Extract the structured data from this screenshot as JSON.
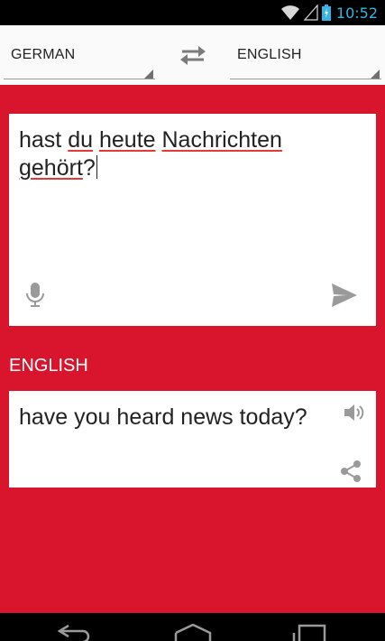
{
  "status_bar": {
    "time": "10:52",
    "icons": [
      "wifi-icon",
      "signal-icon",
      "battery-charging-icon"
    ],
    "time_color": "#33b5e5"
  },
  "language_bar": {
    "source_language": "GERMAN",
    "target_language": "ENGLISH",
    "swap_icon": "swap-arrows-icon"
  },
  "input": {
    "words": [
      "hast",
      "du",
      "heute",
      "Nachrichten",
      "gehört",
      "?"
    ],
    "mic_icon": "microphone-icon",
    "send_icon": "send-icon"
  },
  "result": {
    "language_label": "ENGLISH",
    "translation": "have you heard news today?",
    "speaker_icon": "speaker-icon",
    "share_icon": "share-icon"
  },
  "nav_bar": {
    "icons": [
      "back-icon",
      "home-icon",
      "recent-apps-icon"
    ]
  },
  "colors": {
    "accent_red": "#d8152c",
    "spellcheck_red": "#e53935",
    "header_background": "#fafafa"
  }
}
